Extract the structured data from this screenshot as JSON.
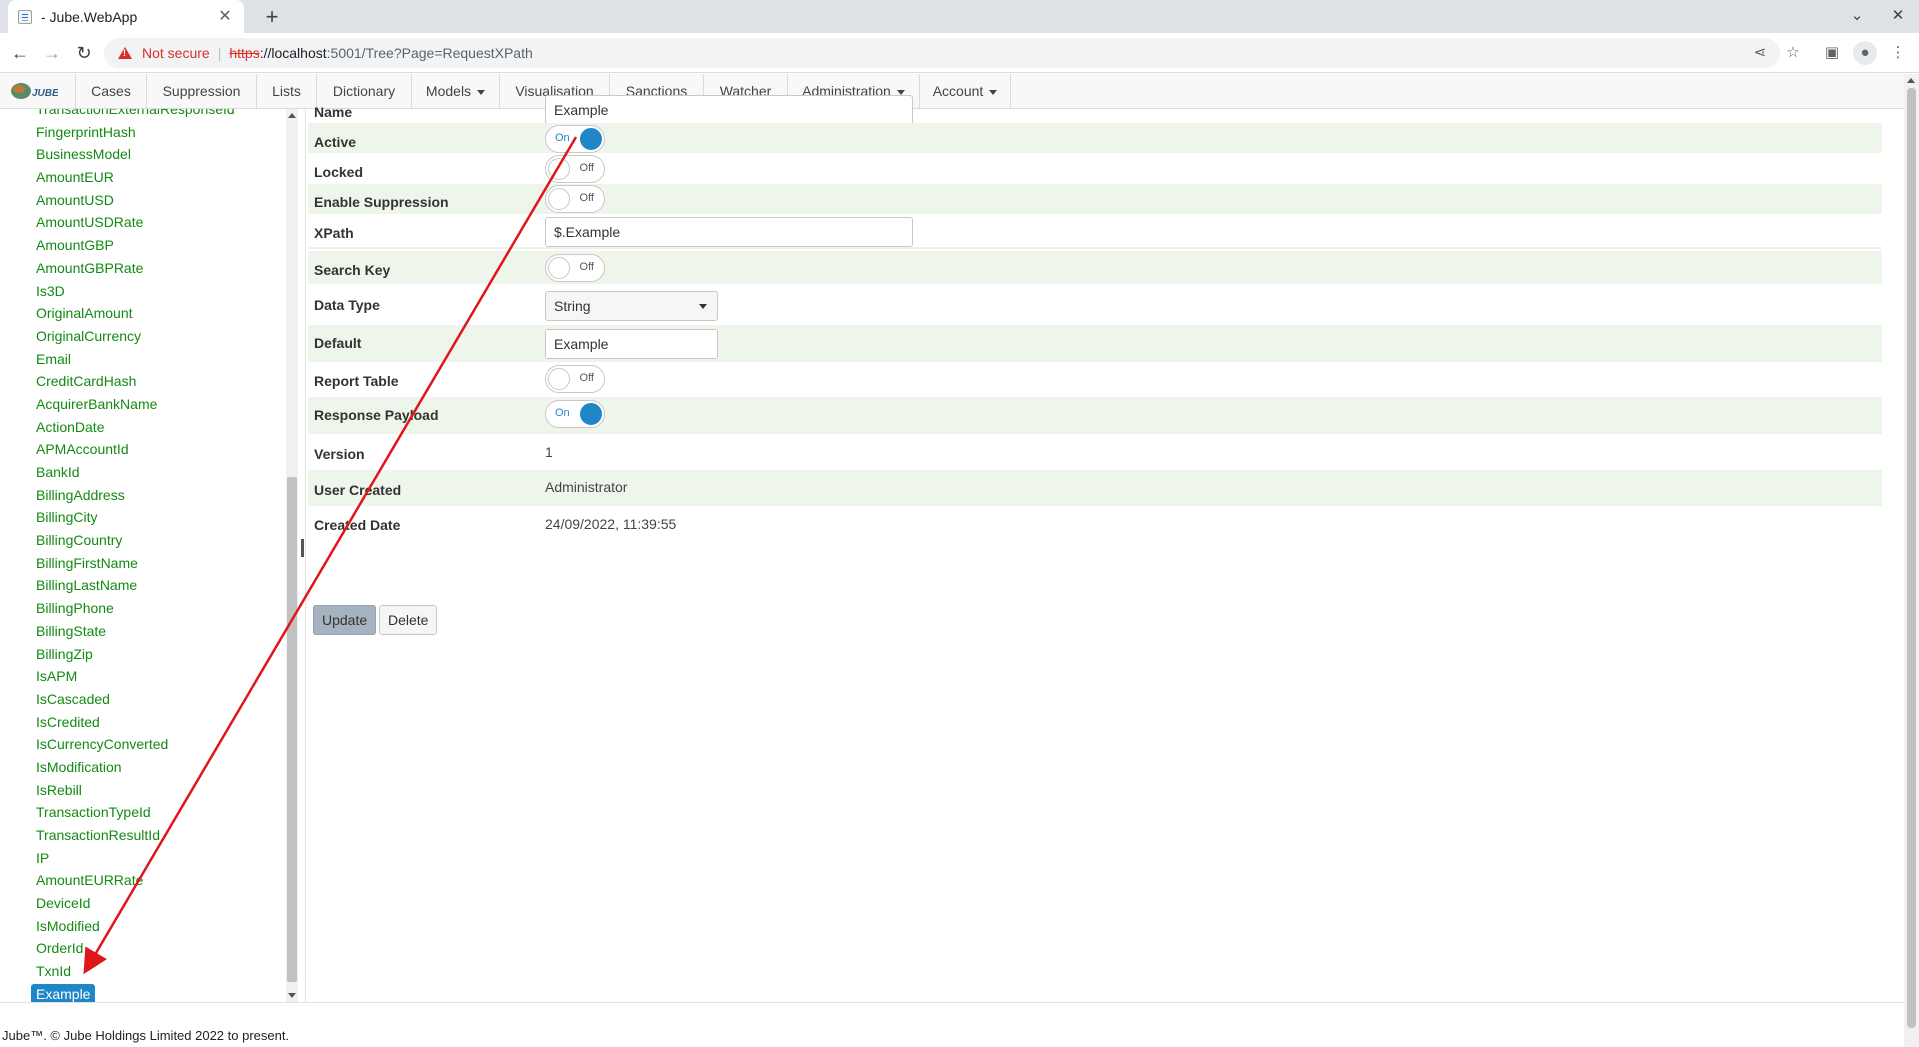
{
  "browser": {
    "tab_title": "- Jube.WebApp",
    "new_tab_symbol": "+",
    "address": {
      "security_label": "Not secure",
      "separator": "|",
      "scheme": "https",
      "host_part": "://localhost",
      "rest": ":5001/Tree?Page=RequestXPath"
    }
  },
  "nav": {
    "logo_text": "JUBE",
    "items": [
      {
        "label": "Cases"
      },
      {
        "label": "Suppression"
      },
      {
        "label": "Lists"
      },
      {
        "label": "Dictionary"
      },
      {
        "label": "Models"
      },
      {
        "label": "Visualisation"
      },
      {
        "label": "Sanctions"
      },
      {
        "label": "Watcher"
      },
      {
        "label": "Administration"
      },
      {
        "label": "Account"
      }
    ]
  },
  "tree": {
    "partial_top_item": "TransactionExternalResponseId",
    "items": [
      "FingerprintHash",
      "BusinessModel",
      "AmountEUR",
      "AmountUSD",
      "AmountUSDRate",
      "AmountGBP",
      "AmountGBPRate",
      "Is3D",
      "OriginalAmount",
      "OriginalCurrency",
      "Email",
      "CreditCardHash",
      "AcquirerBankName",
      "ActionDate",
      "APMAccountId",
      "BankId",
      "BillingAddress",
      "BillingCity",
      "BillingCountry",
      "BillingFirstName",
      "BillingLastName",
      "BillingPhone",
      "BillingState",
      "BillingZip",
      "IsAPM",
      "IsCascaded",
      "IsCredited",
      "IsCurrencyConverted",
      "IsModification",
      "IsRebill",
      "TransactionTypeId",
      "TransactionResultId",
      "IP",
      "AmountEURRate",
      "DeviceId",
      "IsModified",
      "OrderId",
      "TxnId"
    ],
    "selected_item": "Example"
  },
  "form": {
    "name": {
      "label": "Name",
      "value": "Example"
    },
    "active": {
      "label": "Active",
      "state": "On"
    },
    "locked": {
      "label": "Locked",
      "state": "Off"
    },
    "enable_suppression": {
      "label": "Enable Suppression",
      "state": "Off"
    },
    "xpath": {
      "label": "XPath",
      "value": "$.Example"
    },
    "search_key": {
      "label": "Search Key",
      "state": "Off"
    },
    "data_type": {
      "label": "Data Type",
      "value": "String"
    },
    "default": {
      "label": "Default",
      "value": "Example"
    },
    "report_table": {
      "label": "Report Table",
      "state": "Off"
    },
    "response_payload": {
      "label": "Response Payload",
      "state": "On"
    },
    "version": {
      "label": "Version",
      "value": "1"
    },
    "user_created": {
      "label": "User Created",
      "value": "Administrator"
    },
    "created_date": {
      "label": "Created Date",
      "value": "24/09/2022, 11:39:55"
    },
    "update_label": "Update",
    "delete_label": "Delete"
  },
  "footer": {
    "text": "Jube™. © Jube Holdings Limited 2022 to present."
  },
  "colors": {
    "tree_link": "#138a13",
    "selection": "#1f86c7",
    "row_alt": "#eef5ea",
    "annotation_arrow": "#e0161b"
  }
}
